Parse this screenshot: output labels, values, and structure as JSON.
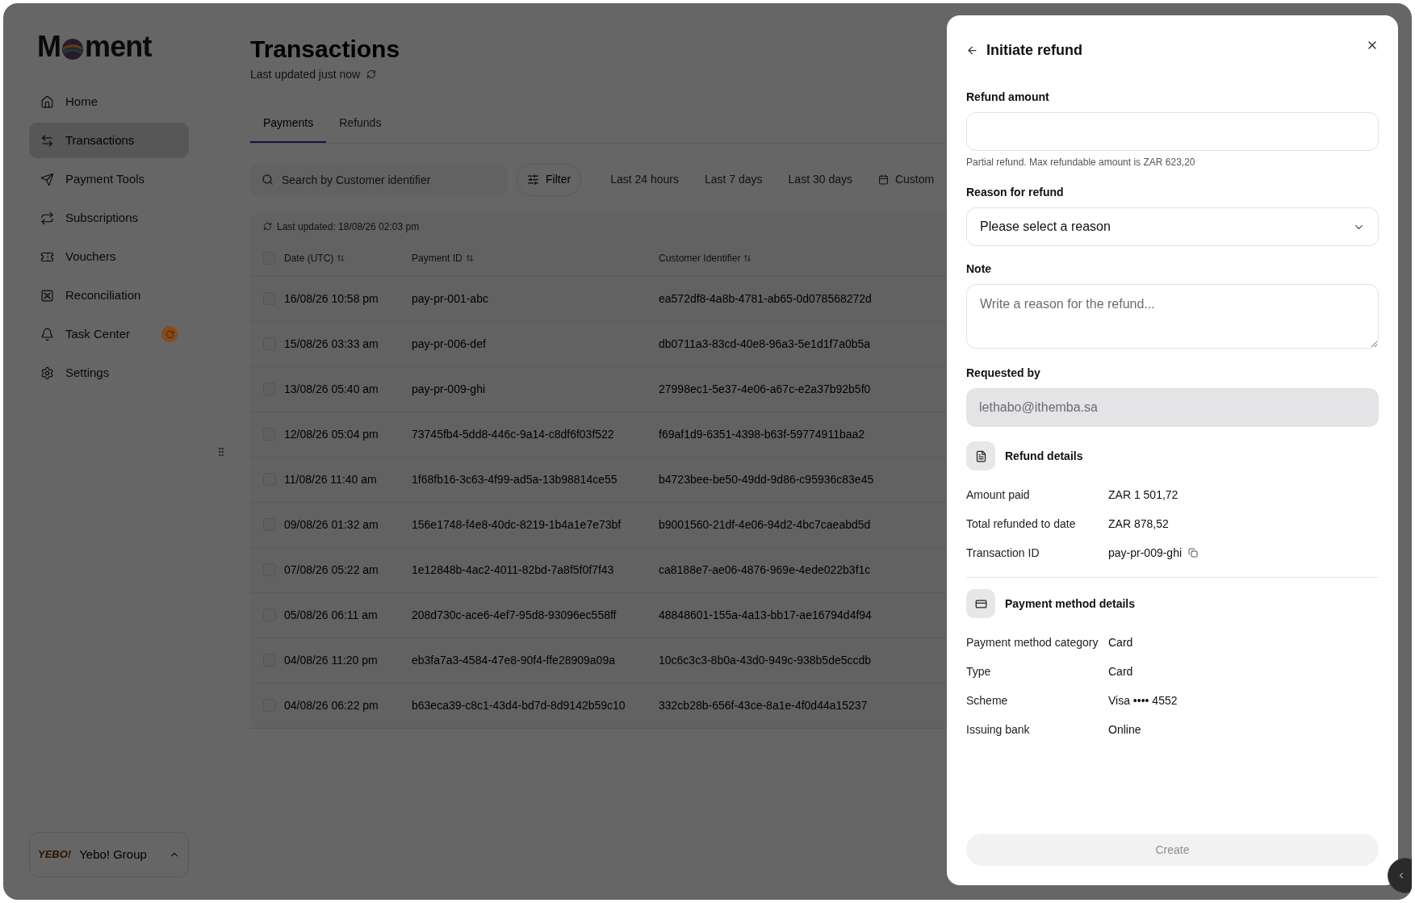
{
  "logo": {
    "lead": "M",
    "trail": "ment"
  },
  "sidebar": {
    "items": [
      {
        "label": "Home",
        "selected": false,
        "alert": false
      },
      {
        "label": "Transactions",
        "selected": true,
        "alert": false
      },
      {
        "label": "Payment Tools",
        "selected": false,
        "alert": false
      },
      {
        "label": "Subscriptions",
        "selected": false,
        "alert": false
      },
      {
        "label": "Vouchers",
        "selected": false,
        "alert": false
      },
      {
        "label": "Reconciliation",
        "selected": false,
        "alert": false
      },
      {
        "label": "Task Center",
        "selected": false,
        "alert": true
      },
      {
        "label": "Settings",
        "selected": false,
        "alert": false
      }
    ],
    "org": {
      "logo": "YEBO!",
      "name": "Yebo! Group"
    }
  },
  "page": {
    "title": "Transactions",
    "subtitle": "Last updated just now"
  },
  "tabs": [
    {
      "label": "Payments",
      "selected": true
    },
    {
      "label": "Refunds",
      "selected": false
    }
  ],
  "search": {
    "placeholder": "Search by Customer identifier"
  },
  "filter_button": "Filter",
  "date_filters": [
    {
      "label": "Last 24 hours",
      "selected": false
    },
    {
      "label": "Last 7 days",
      "selected": false
    },
    {
      "label": "Last 30 days",
      "selected": false
    },
    {
      "label": "Custom",
      "selected": false
    }
  ],
  "table": {
    "updated": "Last updated: 18/08/26 02:03 pm",
    "header_checked": false,
    "columns": [
      "Date (UTC)",
      "Payment ID",
      "Customer Identifier"
    ],
    "rows": [
      {
        "checked": false,
        "cells": [
          "16/08/26 10:58 pm",
          "pay-pr-001-abc",
          "ea572df8-4a8b-4781-ab65-0d078568272d"
        ]
      },
      {
        "checked": false,
        "cells": [
          "15/08/26 03:33 am",
          "pay-pr-006-def",
          "db0711a3-83cd-40e8-96a3-5e1d1f7a0b5a"
        ]
      },
      {
        "checked": false,
        "cells": [
          "13/08/26 05:40 am",
          "pay-pr-009-ghi",
          "27998ec1-5e37-4e06-a67c-e2a37b92b5f0"
        ]
      },
      {
        "checked": false,
        "cells": [
          "12/08/26 05:04 pm",
          "73745fb4-5dd8-446c-9a14-c8df6f03f522",
          "f69af1d9-6351-4398-b63f-59774911baa2"
        ]
      },
      {
        "checked": false,
        "cells": [
          "11/08/26 11:40 am",
          "1f68fb16-3c63-4f99-ad5a-13b98814ce55",
          "b4723bee-be50-49dd-9d86-c95936c83e45"
        ]
      },
      {
        "checked": false,
        "cells": [
          "09/08/26 01:32 am",
          "156e1748-f4e8-40dc-8219-1b4a1e7e73bf",
          "b9001560-21df-4e06-94d2-4bc7caeabd5d"
        ]
      },
      {
        "checked": false,
        "cells": [
          "07/08/26 05:22 am",
          "1e12848b-4ac2-4011-82bd-7a8f5f0f7f43",
          "ca8188e7-ae06-4876-969e-4ede022b3f1c"
        ]
      },
      {
        "checked": false,
        "cells": [
          "05/08/26 06:11 am",
          "208d730c-ace6-4ef7-95d8-93096ec558ff",
          "48848601-155a-4a13-bb17-ae16794d4f94"
        ]
      },
      {
        "checked": false,
        "cells": [
          "04/08/26 11:20 pm",
          "eb3fa7a3-4584-47e8-90f4-ffe28909a09a",
          "10c6c3c3-8b0a-43d0-949c-938b5de5ccdb"
        ]
      },
      {
        "checked": false,
        "cells": [
          "04/08/26 06:22 pm",
          "b63eca39-c8c1-43d4-bd7d-8d9142b59c10",
          "332cb28b-656f-43ce-8a1e-4f0d44a15237"
        ]
      }
    ]
  },
  "refund_panel": {
    "title": "Initiate refund",
    "amount": {
      "label": "Refund amount",
      "hint": "Partial refund. Max refundable amount is ZAR 623,20"
    },
    "reason": {
      "label": "Reason for refund",
      "placeholder": "Please select a reason"
    },
    "note": {
      "label": "Note",
      "placeholder": "Write a reason for the refund..."
    },
    "requested_by": {
      "label": "Requested by",
      "value": "lethabo@ithemba.sa",
      "disabled": true
    },
    "sections": [
      {
        "title": "Refund details",
        "rows": [
          {
            "label": "Amount paid",
            "value": "ZAR 1 501,72",
            "copy": false
          },
          {
            "label": "Total refunded to date",
            "value": "ZAR 878,52",
            "copy": false
          },
          {
            "label": "Transaction ID",
            "value": "pay-pr-009-ghi",
            "copy": true
          }
        ]
      },
      {
        "title": "Payment method details",
        "rows": [
          {
            "label": "Payment method category",
            "value": "Card",
            "copy": false
          },
          {
            "label": "Type",
            "value": "Card",
            "copy": false
          },
          {
            "label": "Scheme",
            "value": "Visa •••• 4552",
            "copy": false
          },
          {
            "label": "Issuing bank",
            "value": "Online",
            "copy": false
          }
        ]
      }
    ],
    "create_button": {
      "label": "Create",
      "disabled": true
    }
  }
}
